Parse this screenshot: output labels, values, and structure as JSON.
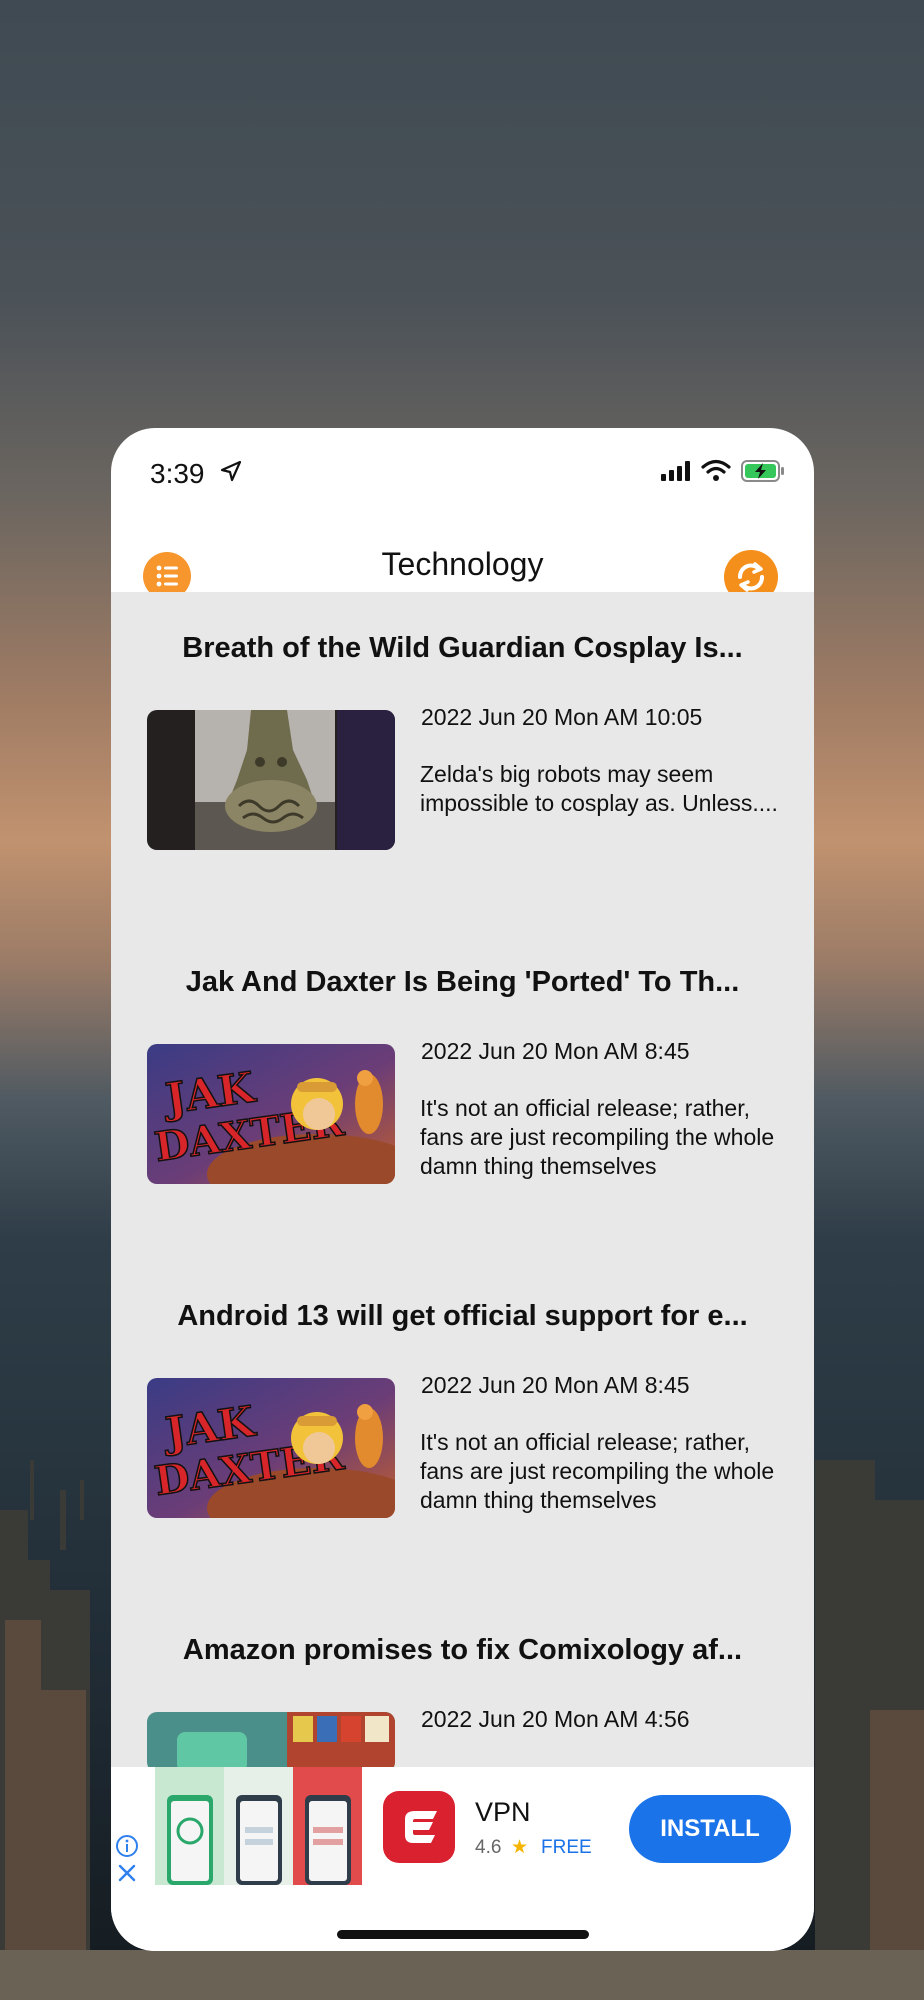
{
  "status_bar": {
    "time": "3:39"
  },
  "nav": {
    "title": "Technology"
  },
  "articles": [
    {
      "title": "Breath of the Wild Guardian Cosplay Is...",
      "date": "2022 Jun 20 Mon AM 10:05",
      "summary": "Zelda's big robots may seem impossible to cosplay as. Unless...."
    },
    {
      "title": "Jak And Daxter Is Being 'Ported' To Th...",
      "date": "2022 Jun 20 Mon AM 8:45",
      "summary": "It's not an official release; rather, fans are just recompiling the whole damn thing themselves"
    },
    {
      "title": "Android 13 will get official support for e...",
      "date": "2022 Jun 20 Mon AM 8:45",
      "summary": "It's not an official release; rather, fans are just recompiling the whole damn thing themselves"
    },
    {
      "title": "Amazon promises to fix Comixology af...",
      "date": "2022 Jun 20 Mon AM 4:56",
      "summary": ""
    }
  ],
  "ad": {
    "app_name": "VPN",
    "rating": "4.6",
    "price": "FREE",
    "install_label": "INSTALL"
  },
  "colors": {
    "accent": "#f6962d",
    "install": "#1a73e8",
    "vpn_brand": "#da2130",
    "list_bg": "#e8e8e8"
  },
  "icons": {
    "menu": "list-icon",
    "refresh": "refresh-icon",
    "location": "location-arrow-icon",
    "signal": "signal-icon",
    "wifi": "wifi-icon",
    "battery": "battery-charging-icon",
    "ad_info": "info-icon",
    "ad_close": "close-icon"
  }
}
